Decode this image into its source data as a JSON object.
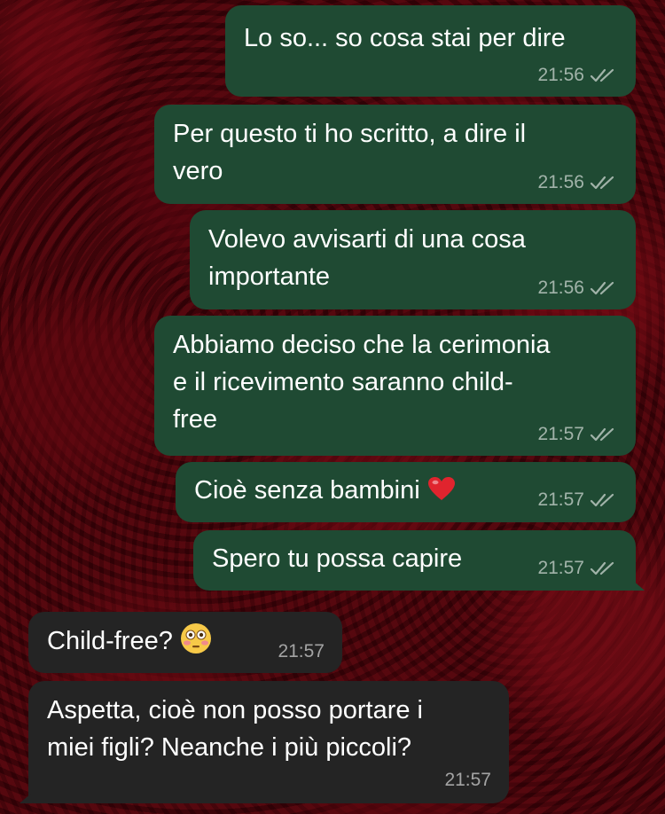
{
  "messages": [
    {
      "text": "Lo so... so cosa stai per dire",
      "time": "21:56"
    },
    {
      "text_line1": "Per questo ti ho scritto, a dire il",
      "text_line2": "vero",
      "time": "21:56"
    },
    {
      "text_line1": "Volevo avvisarti di una cosa",
      "text_line2": "importante",
      "time": "21:56"
    },
    {
      "text_line1": "Abbiamo deciso che la cerimonia",
      "text_line2": "e il ricevimento saranno child-",
      "text_line3": "free",
      "time": "21:57"
    },
    {
      "text": "Cioè senza bambini",
      "emoji": "red-heart",
      "time": "21:57"
    },
    {
      "text": "Spero tu possa capire",
      "time": "21:57"
    },
    {
      "text": "Child-free?",
      "emoji": "flushed-face",
      "time": "21:57"
    },
    {
      "text_line1": "Aspetta, cioè non posso portare i",
      "text_line2": "miei figli? Neanche i più piccoli?",
      "time": "21:57"
    }
  ],
  "colors": {
    "outgoing_bubble": "#1f4a33",
    "incoming_bubble": "#242424",
    "background": "#3a0308",
    "timestamp": "#a8a8a8"
  }
}
